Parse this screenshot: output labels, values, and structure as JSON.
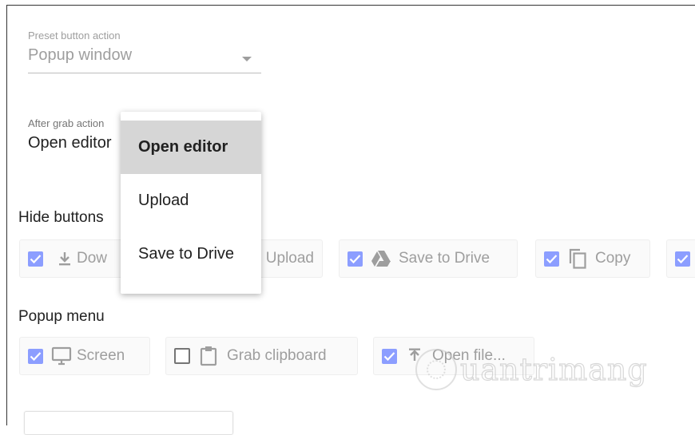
{
  "preset": {
    "label": "Preset button action",
    "value": "Popup window"
  },
  "after_grab": {
    "label": "After grab action",
    "value": "Open editor"
  },
  "dropdown": {
    "options": [
      "Open editor",
      "Upload",
      "Save to Drive"
    ],
    "selected": "Open editor"
  },
  "hide_buttons": {
    "title": "Hide buttons",
    "items": [
      {
        "label": "Download",
        "visible_text": "Dow",
        "checked": true,
        "icon": "download-icon"
      },
      {
        "label": "Upload",
        "checked": true,
        "icon": "upload-icon"
      },
      {
        "label": "Save to Drive",
        "checked": true,
        "icon": "drive-icon"
      },
      {
        "label": "Copy",
        "checked": true,
        "icon": "copy-icon"
      },
      {
        "label": "",
        "checked": true
      }
    ]
  },
  "popup_menu": {
    "title": "Popup menu",
    "items": [
      {
        "label": "Screen",
        "checked": true,
        "icon": "monitor-icon"
      },
      {
        "label": "Grab clipboard",
        "checked": false,
        "icon": "clipboard-icon"
      },
      {
        "label": "Open file...",
        "checked": true,
        "icon": "upload-icon"
      }
    ]
  },
  "watermark": {
    "text": "uantrimang"
  },
  "colors": {
    "checkbox": "#8c9eff",
    "muted_text": "#9e9e9e",
    "selected_bg": "#d6d6d6"
  }
}
